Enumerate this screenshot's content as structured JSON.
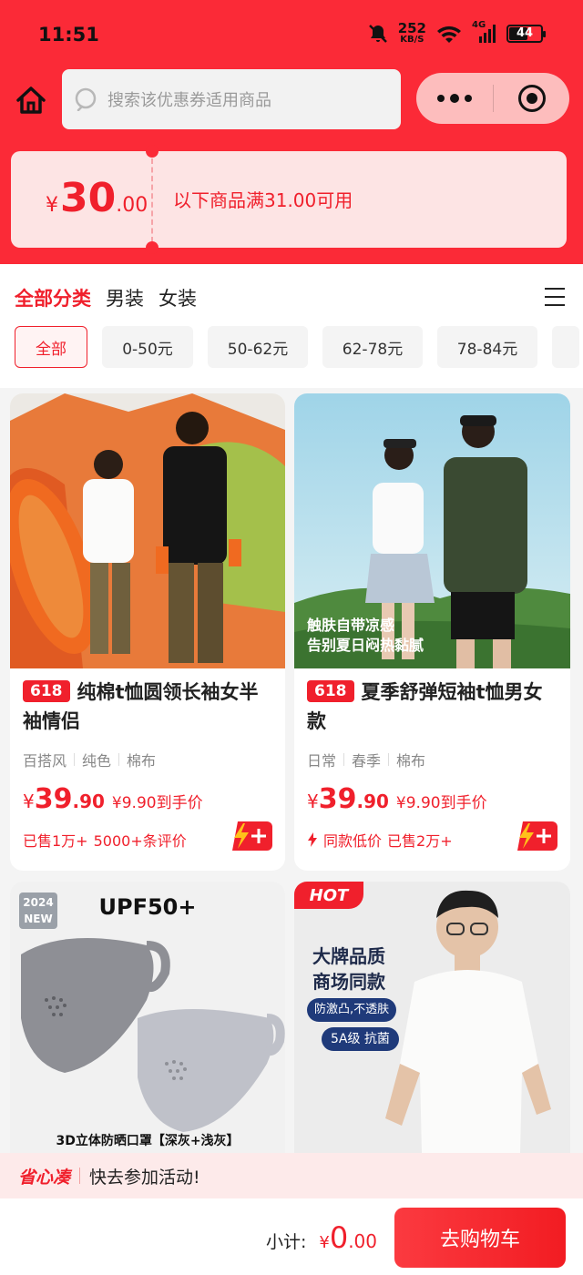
{
  "status_bar": {
    "time": "11:51",
    "speed_value": "252",
    "speed_unit": "KB/S",
    "network": "4G",
    "battery": "44"
  },
  "header": {
    "search_placeholder": "搜索该优惠券适用商品"
  },
  "coupon": {
    "currency": "¥",
    "amount_int": "30",
    "amount_dec": ".00",
    "rule": "以下商品满31.00可用"
  },
  "category_tabs": [
    {
      "label": "全部分类",
      "active": true
    },
    {
      "label": "男装",
      "active": false
    },
    {
      "label": "女装",
      "active": false
    }
  ],
  "price_chips": [
    {
      "label": "全部",
      "active": true
    },
    {
      "label": "0-50元",
      "active": false
    },
    {
      "label": "50-62元",
      "active": false
    },
    {
      "label": "62-78元",
      "active": false
    },
    {
      "label": "78-84元",
      "active": false
    }
  ],
  "products": [
    {
      "tag": "618",
      "title": "纯棉t恤圆领长袖女半袖情侣",
      "attrs": [
        "百搭风",
        "纯色",
        "棉布"
      ],
      "currency": "¥",
      "price_int": "39",
      "price_dec": ".90",
      "net_price": "¥9.90到手价",
      "sold_primary": "已售1万+",
      "sold_secondary": "5000+条评价"
    },
    {
      "tag": "618",
      "title": "夏季舒弹短袖t恤男女款",
      "image_caption_1": "触肤自带凉感",
      "image_caption_2": "告别夏日闷热黏腻",
      "attrs": [
        "日常",
        "春季",
        "棉布"
      ],
      "currency": "¥",
      "price_int": "39",
      "price_dec": ".90",
      "net_price": "¥9.90到手价",
      "sold_primary": "同款低价",
      "sold_secondary": "已售2万+"
    },
    {
      "badge_year": "2024",
      "badge_new": "NEW",
      "headline": "UPF50+",
      "caption": "3D立体防晒口罩【深灰+浅灰】"
    },
    {
      "hot": "HOT",
      "line1": "大牌品质",
      "line2": "商场同款",
      "pill1": "防激凸,不透肤",
      "pill2": "5A级 抗菌"
    }
  ],
  "tip_bar": {
    "brand": "省心凑",
    "text": "快去参加活动!"
  },
  "footer": {
    "subtotal_label": "小计:",
    "currency": "¥",
    "total_int": "0",
    "total_dec": ".00",
    "cart_button": "去购物车"
  },
  "colors": {
    "brand_red": "#fb2a37",
    "price_red": "#f0202c"
  }
}
